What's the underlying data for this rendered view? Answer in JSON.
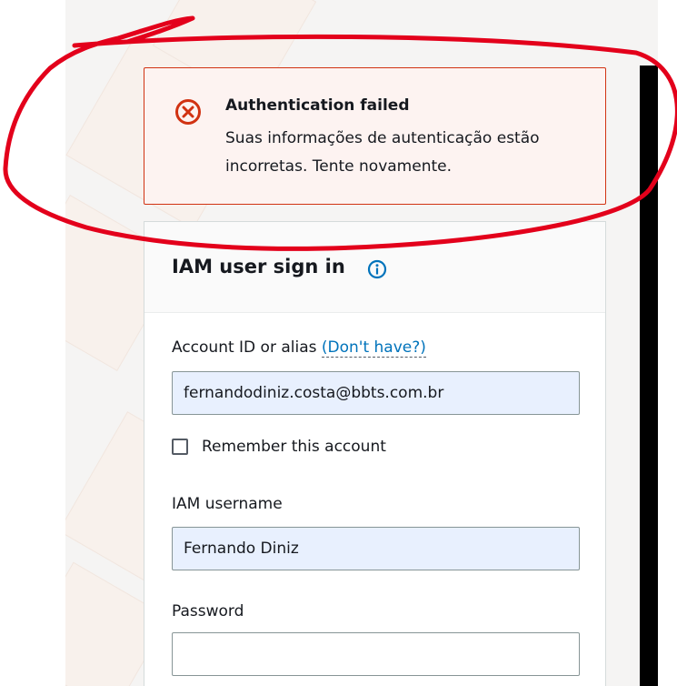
{
  "alert": {
    "title": "Authentication failed",
    "message": "Suas informações de autenticação estão incorretas. Tente novamente.",
    "icon": "error-circle-icon",
    "color": "#d13212"
  },
  "card": {
    "title": "IAM user sign in",
    "info_icon": "info-icon",
    "account": {
      "label": "Account ID or alias",
      "link": "(Don't have?)",
      "value": "fernandodiniz.costa@bbts.com.br"
    },
    "remember": {
      "label": "Remember this account",
      "checked": false
    },
    "username": {
      "label": "IAM username",
      "value": "Fernando Diniz"
    },
    "password": {
      "label": "Password",
      "value": ""
    }
  },
  "colors": {
    "link": "#0073bb",
    "autofill_background": "#e8f0fe",
    "annotation": "#e3001b"
  }
}
